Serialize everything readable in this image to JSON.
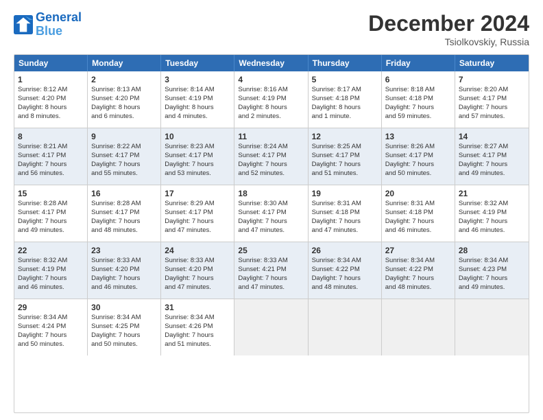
{
  "header": {
    "logo_line1": "General",
    "logo_line2": "Blue",
    "title": "December 2024",
    "subtitle": "Tsiolkovskiy, Russia"
  },
  "days": [
    "Sunday",
    "Monday",
    "Tuesday",
    "Wednesday",
    "Thursday",
    "Friday",
    "Saturday"
  ],
  "rows": [
    [
      {
        "day": "1",
        "lines": [
          "Sunrise: 8:12 AM",
          "Sunset: 4:20 PM",
          "Daylight: 8 hours",
          "and 8 minutes."
        ]
      },
      {
        "day": "2",
        "lines": [
          "Sunrise: 8:13 AM",
          "Sunset: 4:20 PM",
          "Daylight: 8 hours",
          "and 6 minutes."
        ]
      },
      {
        "day": "3",
        "lines": [
          "Sunrise: 8:14 AM",
          "Sunset: 4:19 PM",
          "Daylight: 8 hours",
          "and 4 minutes."
        ]
      },
      {
        "day": "4",
        "lines": [
          "Sunrise: 8:16 AM",
          "Sunset: 4:19 PM",
          "Daylight: 8 hours",
          "and 2 minutes."
        ]
      },
      {
        "day": "5",
        "lines": [
          "Sunrise: 8:17 AM",
          "Sunset: 4:18 PM",
          "Daylight: 8 hours",
          "and 1 minute."
        ]
      },
      {
        "day": "6",
        "lines": [
          "Sunrise: 8:18 AM",
          "Sunset: 4:18 PM",
          "Daylight: 7 hours",
          "and 59 minutes."
        ]
      },
      {
        "day": "7",
        "lines": [
          "Sunrise: 8:20 AM",
          "Sunset: 4:17 PM",
          "Daylight: 7 hours",
          "and 57 minutes."
        ]
      }
    ],
    [
      {
        "day": "8",
        "lines": [
          "Sunrise: 8:21 AM",
          "Sunset: 4:17 PM",
          "Daylight: 7 hours",
          "and 56 minutes."
        ]
      },
      {
        "day": "9",
        "lines": [
          "Sunrise: 8:22 AM",
          "Sunset: 4:17 PM",
          "Daylight: 7 hours",
          "and 55 minutes."
        ]
      },
      {
        "day": "10",
        "lines": [
          "Sunrise: 8:23 AM",
          "Sunset: 4:17 PM",
          "Daylight: 7 hours",
          "and 53 minutes."
        ]
      },
      {
        "day": "11",
        "lines": [
          "Sunrise: 8:24 AM",
          "Sunset: 4:17 PM",
          "Daylight: 7 hours",
          "and 52 minutes."
        ]
      },
      {
        "day": "12",
        "lines": [
          "Sunrise: 8:25 AM",
          "Sunset: 4:17 PM",
          "Daylight: 7 hours",
          "and 51 minutes."
        ]
      },
      {
        "day": "13",
        "lines": [
          "Sunrise: 8:26 AM",
          "Sunset: 4:17 PM",
          "Daylight: 7 hours",
          "and 50 minutes."
        ]
      },
      {
        "day": "14",
        "lines": [
          "Sunrise: 8:27 AM",
          "Sunset: 4:17 PM",
          "Daylight: 7 hours",
          "and 49 minutes."
        ]
      }
    ],
    [
      {
        "day": "15",
        "lines": [
          "Sunrise: 8:28 AM",
          "Sunset: 4:17 PM",
          "Daylight: 7 hours",
          "and 49 minutes."
        ]
      },
      {
        "day": "16",
        "lines": [
          "Sunrise: 8:28 AM",
          "Sunset: 4:17 PM",
          "Daylight: 7 hours",
          "and 48 minutes."
        ]
      },
      {
        "day": "17",
        "lines": [
          "Sunrise: 8:29 AM",
          "Sunset: 4:17 PM",
          "Daylight: 7 hours",
          "and 47 minutes."
        ]
      },
      {
        "day": "18",
        "lines": [
          "Sunrise: 8:30 AM",
          "Sunset: 4:17 PM",
          "Daylight: 7 hours",
          "and 47 minutes."
        ]
      },
      {
        "day": "19",
        "lines": [
          "Sunrise: 8:31 AM",
          "Sunset: 4:18 PM",
          "Daylight: 7 hours",
          "and 47 minutes."
        ]
      },
      {
        "day": "20",
        "lines": [
          "Sunrise: 8:31 AM",
          "Sunset: 4:18 PM",
          "Daylight: 7 hours",
          "and 46 minutes."
        ]
      },
      {
        "day": "21",
        "lines": [
          "Sunrise: 8:32 AM",
          "Sunset: 4:19 PM",
          "Daylight: 7 hours",
          "and 46 minutes."
        ]
      }
    ],
    [
      {
        "day": "22",
        "lines": [
          "Sunrise: 8:32 AM",
          "Sunset: 4:19 PM",
          "Daylight: 7 hours",
          "and 46 minutes."
        ]
      },
      {
        "day": "23",
        "lines": [
          "Sunrise: 8:33 AM",
          "Sunset: 4:20 PM",
          "Daylight: 7 hours",
          "and 46 minutes."
        ]
      },
      {
        "day": "24",
        "lines": [
          "Sunrise: 8:33 AM",
          "Sunset: 4:20 PM",
          "Daylight: 7 hours",
          "and 47 minutes."
        ]
      },
      {
        "day": "25",
        "lines": [
          "Sunrise: 8:33 AM",
          "Sunset: 4:21 PM",
          "Daylight: 7 hours",
          "and 47 minutes."
        ]
      },
      {
        "day": "26",
        "lines": [
          "Sunrise: 8:34 AM",
          "Sunset: 4:22 PM",
          "Daylight: 7 hours",
          "and 48 minutes."
        ]
      },
      {
        "day": "27",
        "lines": [
          "Sunrise: 8:34 AM",
          "Sunset: 4:22 PM",
          "Daylight: 7 hours",
          "and 48 minutes."
        ]
      },
      {
        "day": "28",
        "lines": [
          "Sunrise: 8:34 AM",
          "Sunset: 4:23 PM",
          "Daylight: 7 hours",
          "and 49 minutes."
        ]
      }
    ],
    [
      {
        "day": "29",
        "lines": [
          "Sunrise: 8:34 AM",
          "Sunset: 4:24 PM",
          "Daylight: 7 hours",
          "and 50 minutes."
        ]
      },
      {
        "day": "30",
        "lines": [
          "Sunrise: 8:34 AM",
          "Sunset: 4:25 PM",
          "Daylight: 7 hours",
          "and 50 minutes."
        ]
      },
      {
        "day": "31",
        "lines": [
          "Sunrise: 8:34 AM",
          "Sunset: 4:26 PM",
          "Daylight: 7 hours",
          "and 51 minutes."
        ]
      },
      {
        "day": "",
        "lines": []
      },
      {
        "day": "",
        "lines": []
      },
      {
        "day": "",
        "lines": []
      },
      {
        "day": "",
        "lines": []
      }
    ]
  ]
}
